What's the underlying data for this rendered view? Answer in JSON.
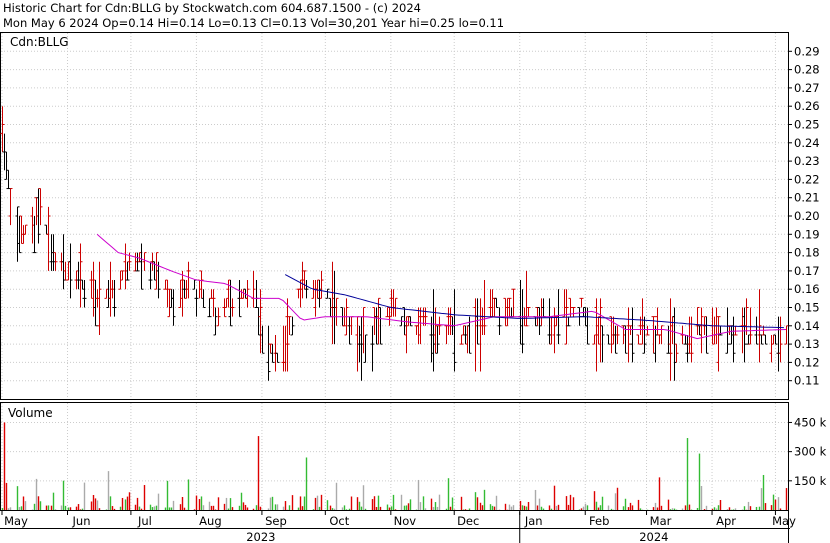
{
  "header": {
    "line1": "Historic Chart for Cdn:BLLG by Stockwatch.com 604.687.1500 - (c) 2024",
    "line2": "Mon May  6 2024  Op=0.14  Hi=0.14  Lo=0.13  Cl=0.13  Vol=30,201  Year hi=0.25  lo=0.11"
  },
  "colors": {
    "up": "#cc0000",
    "down": "#000000",
    "ma_short": "#cc00cc",
    "ma_long": "#000099",
    "vol_red": "#dd0000",
    "vol_green": "#33bb33",
    "vol_gray": "#aaaaaa",
    "grid": "#cccccc"
  },
  "chart_data": [
    {
      "type": "ohlc",
      "symbol_label": "Cdn:BLLG",
      "y_ticks": [
        "0.29",
        "0.28",
        "0.27",
        "0.26",
        "0.25",
        "0.24",
        "0.23",
        "0.22",
        "0.21",
        "0.20",
        "0.19",
        "0.18",
        "0.17",
        "0.16",
        "0.15",
        "0.14",
        "0.13",
        "0.12",
        "0.11"
      ],
      "ylim": [
        0.1,
        0.3
      ],
      "x_months": [
        "May",
        "Jun",
        "Jul",
        "Aug",
        "Sep",
        "Oct",
        "Nov",
        "Dec",
        "Jan",
        "Feb",
        "Mar",
        "Apr",
        "May"
      ],
      "x_years": [
        "2023",
        "2024"
      ],
      "grid": true,
      "series": [
        {
          "price_kind": "daily OHLC"
        },
        {
          "price_kind": "moving average short"
        },
        {
          "price_kind": "moving average long"
        }
      ],
      "anchors": [
        {
          "date": "2023-05-01",
          "price": 0.25
        },
        {
          "date": "2023-05-03",
          "price": 0.23
        },
        {
          "date": "2023-05-06",
          "price": 0.19
        },
        {
          "date": "2023-05-12",
          "price": 0.19
        },
        {
          "date": "2023-05-20",
          "price": 0.2
        },
        {
          "date": "2023-05-25",
          "price": 0.18
        },
        {
          "date": "2023-06-01",
          "price": 0.17
        },
        {
          "date": "2023-06-10",
          "price": 0.16
        },
        {
          "date": "2023-06-20",
          "price": 0.155
        },
        {
          "date": "2023-06-28",
          "price": 0.17
        },
        {
          "date": "2023-07-05",
          "price": 0.175
        },
        {
          "date": "2023-07-12",
          "price": 0.17
        },
        {
          "date": "2023-07-20",
          "price": 0.155
        },
        {
          "date": "2023-07-28",
          "price": 0.16
        },
        {
          "date": "2023-08-05",
          "price": 0.16
        },
        {
          "date": "2023-08-12",
          "price": 0.145
        },
        {
          "date": "2023-08-20",
          "price": 0.155
        },
        {
          "date": "2023-08-28",
          "price": 0.16
        },
        {
          "date": "2023-09-02",
          "price": 0.13
        },
        {
          "date": "2023-09-08",
          "price": 0.12
        },
        {
          "date": "2023-09-14",
          "price": 0.135
        },
        {
          "date": "2023-09-20",
          "price": 0.165
        },
        {
          "date": "2023-09-28",
          "price": 0.16
        },
        {
          "date": "2023-10-05",
          "price": 0.15
        },
        {
          "date": "2023-10-12",
          "price": 0.14
        },
        {
          "date": "2023-10-18",
          "price": 0.13
        },
        {
          "date": "2023-10-25",
          "price": 0.14
        },
        {
          "date": "2023-11-01",
          "price": 0.15
        },
        {
          "date": "2023-11-10",
          "price": 0.14
        },
        {
          "date": "2023-11-20",
          "price": 0.14
        },
        {
          "date": "2023-11-28",
          "price": 0.14
        },
        {
          "date": "2023-12-05",
          "price": 0.135
        },
        {
          "date": "2023-12-12",
          "price": 0.14
        },
        {
          "date": "2023-12-20",
          "price": 0.15
        },
        {
          "date": "2024-01-01",
          "price": 0.145
        },
        {
          "date": "2024-01-10",
          "price": 0.145
        },
        {
          "date": "2024-01-20",
          "price": 0.145
        },
        {
          "date": "2024-01-30",
          "price": 0.15
        },
        {
          "date": "2024-02-05",
          "price": 0.135
        },
        {
          "date": "2024-02-15",
          "price": 0.135
        },
        {
          "date": "2024-02-25",
          "price": 0.135
        },
        {
          "date": "2024-03-05",
          "price": 0.135
        },
        {
          "date": "2024-03-15",
          "price": 0.13
        },
        {
          "date": "2024-03-25",
          "price": 0.14
        },
        {
          "date": "2024-04-05",
          "price": 0.135
        },
        {
          "date": "2024-04-15",
          "price": 0.135
        },
        {
          "date": "2024-04-25",
          "price": 0.135
        },
        {
          "date": "2024-05-06",
          "price": 0.13
        }
      ],
      "ma_short_anchors": [
        {
          "date": "2023-06-15",
          "price": 0.19
        },
        {
          "date": "2023-06-25",
          "price": 0.18
        },
        {
          "date": "2023-07-05",
          "price": 0.177
        },
        {
          "date": "2023-07-20",
          "price": 0.17
        },
        {
          "date": "2023-08-01",
          "price": 0.165
        },
        {
          "date": "2023-08-15",
          "price": 0.163
        },
        {
          "date": "2023-08-28",
          "price": 0.155
        },
        {
          "date": "2023-09-10",
          "price": 0.155
        },
        {
          "date": "2023-09-20",
          "price": 0.143
        },
        {
          "date": "2023-10-01",
          "price": 0.145
        },
        {
          "date": "2023-10-20",
          "price": 0.145
        },
        {
          "date": "2023-11-10",
          "price": 0.142
        },
        {
          "date": "2023-12-01",
          "price": 0.14
        },
        {
          "date": "2023-12-20",
          "price": 0.145
        },
        {
          "date": "2024-01-15",
          "price": 0.145
        },
        {
          "date": "2024-02-05",
          "price": 0.148
        },
        {
          "date": "2024-02-20",
          "price": 0.138
        },
        {
          "date": "2024-03-10",
          "price": 0.138
        },
        {
          "date": "2024-03-25",
          "price": 0.133
        },
        {
          "date": "2024-04-10",
          "price": 0.137
        },
        {
          "date": "2024-05-06",
          "price": 0.138
        }
      ],
      "ma_long_anchors": [
        {
          "date": "2023-09-12",
          "price": 0.168
        },
        {
          "date": "2023-09-25",
          "price": 0.16
        },
        {
          "date": "2023-10-10",
          "price": 0.157
        },
        {
          "date": "2023-11-01",
          "price": 0.15
        },
        {
          "date": "2023-12-01",
          "price": 0.146
        },
        {
          "date": "2024-01-01",
          "price": 0.144
        },
        {
          "date": "2024-02-01",
          "price": 0.145
        },
        {
          "date": "2024-03-01",
          "price": 0.143
        },
        {
          "date": "2024-04-01",
          "price": 0.14
        },
        {
          "date": "2024-05-06",
          "price": 0.139
        }
      ]
    },
    {
      "type": "bar",
      "title": "Volume",
      "y_ticks": [
        "450 k",
        "300 k",
        "150 k"
      ],
      "ylim": [
        0,
        550
      ],
      "unit": "k",
      "peaks": [
        {
          "date": "2023-05-02",
          "value": 450,
          "color": "red"
        },
        {
          "date": "2023-06-20",
          "value": 200,
          "color": "gray"
        },
        {
          "date": "2023-07-18",
          "value": 150,
          "color": "green"
        },
        {
          "date": "2023-08-30",
          "value": 380,
          "color": "red"
        },
        {
          "date": "2023-09-22",
          "value": 270,
          "color": "green"
        },
        {
          "date": "2023-10-06",
          "value": 140,
          "color": "gray"
        },
        {
          "date": "2023-12-02",
          "value": 350,
          "color": "green"
        },
        {
          "date": "2024-01-20",
          "value": 100,
          "color": "red"
        },
        {
          "date": "2024-03-20",
          "value": 370,
          "color": "green"
        },
        {
          "date": "2024-03-26",
          "value": 290,
          "color": "green"
        },
        {
          "date": "2024-04-25",
          "value": 180,
          "color": "green"
        }
      ]
    }
  ]
}
